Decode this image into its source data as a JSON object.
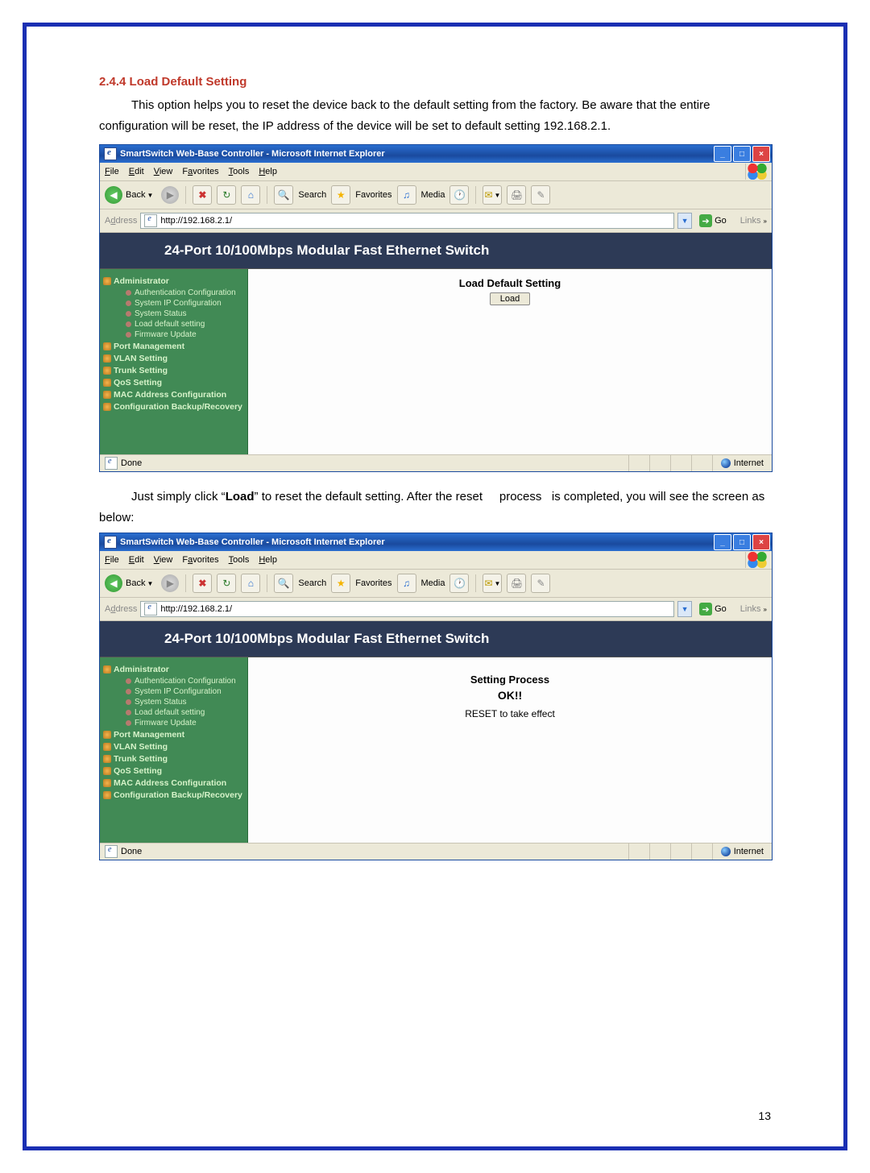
{
  "doc": {
    "heading": "2.4.4 Load Default Setting",
    "p1": "This option helps you to reset the device back to the default setting from the factory. Be aware that the entire configuration will be reset, the IP address of the  device will be set to default setting 192.168.2.1.",
    "p2a": "Just simply click “",
    "p2b": "Load",
    "p2c": "” to reset the default setting. After the reset",
    "p2d": "process",
    "p2e": "is completed, you will see the screen as below:",
    "page_number": "13"
  },
  "ie": {
    "title": "SmartSwitch Web-Base Controller - Microsoft Internet Explorer",
    "ctrls": {
      "min": "_",
      "max": "□",
      "close": "×"
    },
    "menus": [
      "File",
      "Edit",
      "View",
      "Favorites",
      "Tools",
      "Help"
    ],
    "toolbar": {
      "back": "Back",
      "search": "Search",
      "favorites": "Favorites",
      "media": "Media"
    },
    "address_label": "Address",
    "address": "http://192.168.2.1/",
    "go": "Go",
    "links": "Links",
    "status_done": "Done",
    "status_zone": "Internet"
  },
  "app": {
    "banner": "24-Port 10/100Mbps Modular Fast Ethernet Switch",
    "menu": {
      "administrator": "Administrator",
      "admin_items": [
        "Authentication Configuration",
        "System IP Configuration",
        "System Status",
        "Load default setting",
        "Firmware Update"
      ],
      "sections": [
        "Port Management",
        "VLAN Setting",
        "Trunk Setting",
        "QoS Setting",
        "MAC Address Configuration",
        "Configuration Backup/Recovery"
      ]
    },
    "content1": {
      "title": "Load Default Setting",
      "button": "Load"
    },
    "content2": {
      "title": "Setting Process",
      "ok": "OK!!",
      "msg": "RESET to take effect"
    }
  }
}
